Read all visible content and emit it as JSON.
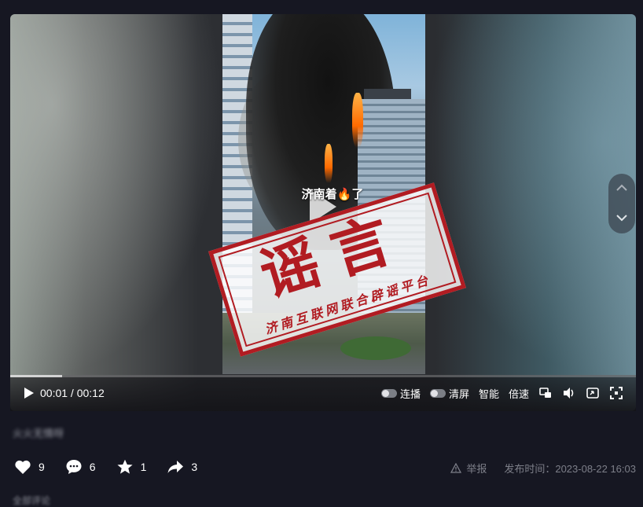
{
  "video": {
    "caption": "济南着🔥了",
    "stamp_text": "谣言",
    "stamp_subtitle": "济南互联网联合辟谣平台",
    "progress": 0.083
  },
  "controls": {
    "current_time": "00:01",
    "separator": " / ",
    "duration": "00:12",
    "continuous_play_label": "连播",
    "clear_screen_label": "清屏",
    "smart_label": "智能",
    "speed_label": "倍速"
  },
  "post": {
    "title": "火火无情呀"
  },
  "actions": {
    "likes": "9",
    "comments": "6",
    "favorites": "1",
    "shares": "3"
  },
  "meta": {
    "report_label": "举报",
    "publish_time": "发布时间：2023-08-22 16:03"
  },
  "footer": {
    "more_text": "全部评论"
  },
  "colors": {
    "background": "#161722",
    "stamp_red": "#b11c22",
    "muted_text": "#7d7f89"
  }
}
